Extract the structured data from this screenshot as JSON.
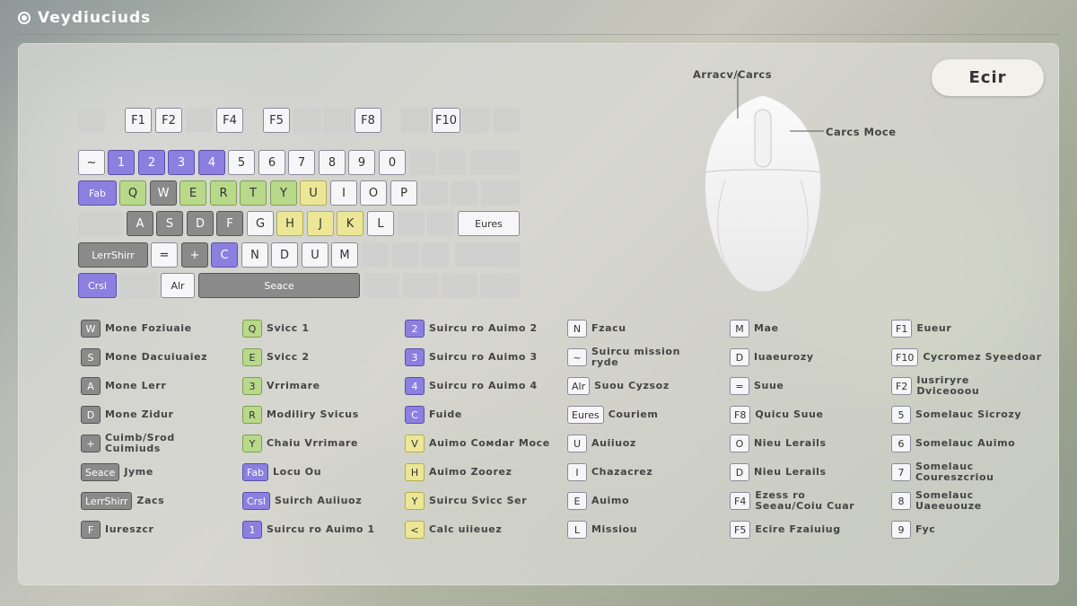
{
  "header": {
    "title": "Veydiuciuds"
  },
  "exit_label": "Ecir",
  "mouse": {
    "left_label": "Arracv/Carcs",
    "right_label": "Carcs Moce"
  },
  "keys": {
    "f1": "F1",
    "f2": "F2",
    "f4": "F4",
    "f5": "F5",
    "f8": "F8",
    "f10": "F10",
    "tilde": "~",
    "n1": "1",
    "n2": "2",
    "n3": "3",
    "n4": "4",
    "n5": "5",
    "n6": "6",
    "n7": "7",
    "n8": "8",
    "n9": "9",
    "n0": "0",
    "tab": "Fab",
    "q": "Q",
    "w": "W",
    "e": "E",
    "r": "R",
    "t": "T",
    "y": "Y",
    "u": "U",
    "i": "I",
    "o": "O",
    "p": "P",
    "a": "A",
    "s": "S",
    "d": "D",
    "f": "F",
    "g": "G",
    "h": "H",
    "j": "J",
    "k": "K",
    "l": "L",
    "enter": "Eures",
    "shift": "LerrShirr",
    "z": "=",
    "x": "+",
    "c": "C",
    "v": "N",
    "b": "D",
    "n": "U",
    "m": "M",
    "ctrl": "Crsl",
    "alt": "Alr",
    "space": "Seace"
  },
  "legend": [
    {
      "key": "W",
      "label": "Mone Foziuaie",
      "color": "gray"
    },
    {
      "key": "S",
      "label": "Mone Dacuiuaiez",
      "color": "gray"
    },
    {
      "key": "A",
      "label": "Mone Lerr",
      "color": "gray"
    },
    {
      "key": "D",
      "label": "Mone Zidur",
      "color": "gray"
    },
    {
      "key": "+",
      "label": "Cuimb/Srod Cuimiuds",
      "color": "gray"
    },
    {
      "key": "Seace",
      "label": "Jyme",
      "color": "gray"
    },
    {
      "key": "LerrShirr",
      "label": "Zacs",
      "color": "gray"
    },
    {
      "key": "F",
      "label": "Iureszcr",
      "color": "gray"
    },
    {
      "key": "Q",
      "label": "Svicc 1",
      "color": "green"
    },
    {
      "key": "E",
      "label": "Svicc 2",
      "color": "green"
    },
    {
      "key": "3",
      "label": "Vrrimare",
      "color": "green"
    },
    {
      "key": "R",
      "label": "Modiliry Svicus",
      "color": "green"
    },
    {
      "key": "Y",
      "label": "Chaiu Vrrimare",
      "color": "green"
    },
    {
      "key": "Fab",
      "label": "Locu Ou",
      "color": "purple"
    },
    {
      "key": "Crsl",
      "label": "Suirch Auiiuoz",
      "color": "purple"
    },
    {
      "key": "1",
      "label": "Suircu ro Auimo 1",
      "color": "purple"
    },
    {
      "key": "2",
      "label": "Suircu ro Auimo 2",
      "color": "purple"
    },
    {
      "key": "3",
      "label": "Suircu ro Auimo 3",
      "color": "purple"
    },
    {
      "key": "4",
      "label": "Suircu ro Auimo 4",
      "color": "purple"
    },
    {
      "key": "C",
      "label": "Fuide",
      "color": "purple"
    },
    {
      "key": "V",
      "label": "Auimo Coмdar Moce",
      "color": "yellow"
    },
    {
      "key": "H",
      "label": "Auimo Zoorez",
      "color": "yellow"
    },
    {
      "key": "Y",
      "label": "Suircu Svicc Ser",
      "color": "yellow"
    },
    {
      "key": "<",
      "label": "Calc uiieuez",
      "color": "yellow"
    },
    {
      "key": "N",
      "label": "Fzacu",
      "color": "white"
    },
    {
      "key": "~",
      "label": "Suircu mission ryde",
      "color": "white"
    },
    {
      "key": "Alr",
      "label": "Suou Cyzsoz",
      "color": "white"
    },
    {
      "key": "Eures",
      "label": "Couriem",
      "color": "white"
    },
    {
      "key": "U",
      "label": "Auiiuoz",
      "color": "white"
    },
    {
      "key": "I",
      "label": "Chazacrez",
      "color": "white"
    },
    {
      "key": "E",
      "label": "Auimo",
      "color": "white"
    },
    {
      "key": "L",
      "label": "Missiou",
      "color": "white"
    },
    {
      "key": "M",
      "label": "Mae",
      "color": "white"
    },
    {
      "key": "D",
      "label": "Iuaeurozy",
      "color": "white"
    },
    {
      "key": "=",
      "label": "Suue",
      "color": "white"
    },
    {
      "key": "F8",
      "label": "Quicu Suue",
      "color": "white"
    },
    {
      "key": "O",
      "label": "Nieu Lerails",
      "color": "white"
    },
    {
      "key": "D",
      "label": "Nieu Lerails",
      "color": "white"
    },
    {
      "key": "F4",
      "label": "Ezess ro Seeau/Coiu Cuar",
      "color": "white"
    },
    {
      "key": "F5",
      "label": "Ecire Fzaiuiug",
      "color": "white"
    },
    {
      "key": "F1",
      "label": "Eueur",
      "color": "white"
    },
    {
      "key": "F10",
      "label": "Cycromez Syeedoar",
      "color": "white"
    },
    {
      "key": "F2",
      "label": "Iusriryre Dviceooou",
      "color": "white"
    },
    {
      "key": "5",
      "label": "Somelauc Sicrozy",
      "color": "white"
    },
    {
      "key": "6",
      "label": "Somelauc Auimo",
      "color": "white"
    },
    {
      "key": "7",
      "label": "Somelauc Coureszcriou",
      "color": "white"
    },
    {
      "key": "8",
      "label": "Somelauc Uaeeuouze",
      "color": "white"
    },
    {
      "key": "9",
      "label": "Fyc",
      "color": "white"
    }
  ]
}
